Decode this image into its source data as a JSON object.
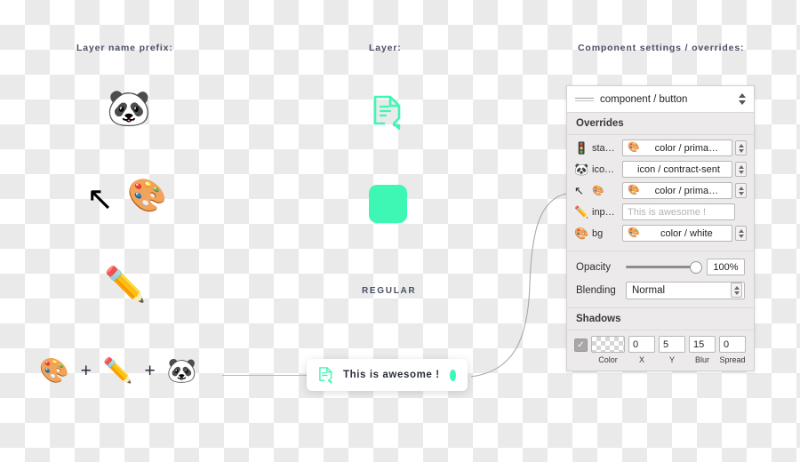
{
  "columns": {
    "left_header": "Layer name prefix:",
    "middle_header": "Layer:",
    "right_header": "Component settings / overrides:"
  },
  "left_column": {
    "samples": [
      {
        "icon": "panda-face-emoji",
        "glyph": "🐼"
      },
      {
        "icon": "upper-left-arrow-emoji",
        "glyph": "↖"
      },
      {
        "icon": "artist-palette-emoji",
        "glyph": "🎨"
      },
      {
        "icon": "pencil-emoji",
        "glyph": "✏️"
      }
    ],
    "formula": {
      "first": "🎨",
      "plus_1": "+",
      "second": "✏️",
      "plus_2": "+",
      "third": "🐼"
    }
  },
  "middle_column": {
    "doc_icon_name": "document-with-arrow-icon",
    "swatch_color": "#3FF7B4",
    "weight_label": "REGULAR"
  },
  "component_button": {
    "icon_name": "document-with-arrow-icon",
    "label": "This is awesome !",
    "dot_color": "#3FF7B4"
  },
  "panel": {
    "component_name": "component / button",
    "overrides_header": "Overrides",
    "overrides": [
      {
        "icon_glyph": "🚦",
        "icon_name": "traffic-light-emoji",
        "name": "sta…",
        "value_emoji": "🎨",
        "value": "color / prima…",
        "has_stepper": true,
        "is_placeholder": false,
        "align": "center"
      },
      {
        "icon_glyph": "🐼",
        "icon_name": "panda-face-emoji",
        "name": "ico…",
        "value_emoji": "",
        "value": "icon / contract-sent",
        "has_stepper": true,
        "is_placeholder": false,
        "align": "center"
      },
      {
        "icon_glyph": "↖",
        "icon_name": "upper-left-arrow-emoji",
        "name": "🎨",
        "value_emoji": "🎨",
        "value": "color / prima…",
        "has_stepper": true,
        "is_placeholder": false,
        "align": "center"
      },
      {
        "icon_glyph": "✏️",
        "icon_name": "pencil-emoji",
        "name": "inp…",
        "value_emoji": "",
        "value": "This is awesome !",
        "has_stepper": false,
        "is_placeholder": true,
        "align": "left"
      },
      {
        "icon_glyph": "🎨",
        "icon_name": "artist-palette-emoji",
        "name": "bg",
        "value_emoji": "🎨",
        "value": "color / white",
        "has_stepper": true,
        "is_placeholder": false,
        "align": "center"
      }
    ],
    "opacity": {
      "label": "Opacity",
      "value": "100%",
      "slider_percent": 100
    },
    "blending": {
      "label": "Blending",
      "value": "Normal"
    },
    "shadows": {
      "header": "Shadows",
      "enabled": true,
      "fields": [
        {
          "label": "Color",
          "value": ""
        },
        {
          "label": "X",
          "value": "0"
        },
        {
          "label": "Y",
          "value": "5"
        },
        {
          "label": "Blur",
          "value": "15"
        },
        {
          "label": "Spread",
          "value": "0"
        }
      ]
    }
  }
}
